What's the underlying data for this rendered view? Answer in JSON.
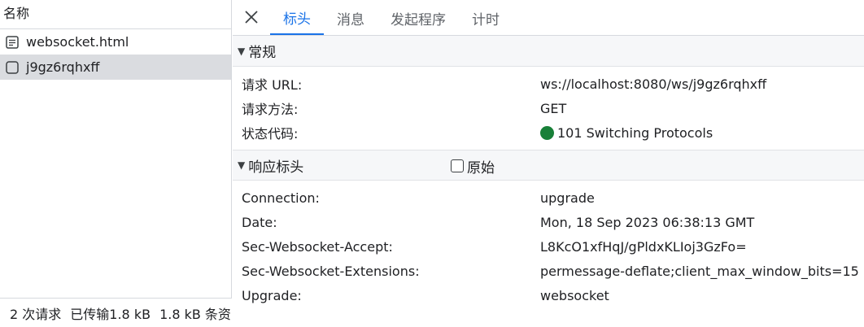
{
  "left": {
    "header": "名称",
    "requests": [
      {
        "name": "websocket.html",
        "icon": "document-icon"
      },
      {
        "name": "j9gz6rqhxff",
        "icon": "websocket-icon"
      }
    ],
    "status": {
      "requests": "2 次请求",
      "transferred": "已传输1.8 kB",
      "resources": "1.8 kB 条资"
    }
  },
  "tabs": {
    "items": [
      "标头",
      "消息",
      "发起程序",
      "计时"
    ],
    "active": "标头"
  },
  "general": {
    "title": "常规",
    "rows": [
      {
        "key": "请求 URL:",
        "value": "ws://localhost:8080/ws/j9gz6rqhxff"
      },
      {
        "key": "请求方法:",
        "value": "GET"
      },
      {
        "key": "状态代码:",
        "value": "101 Switching Protocols"
      }
    ],
    "status_color": "#188038"
  },
  "response_headers": {
    "title": "响应标头",
    "raw_label": "原始",
    "rows": [
      {
        "key": "Connection:",
        "value": "upgrade"
      },
      {
        "key": "Date:",
        "value": "Mon, 18 Sep 2023 06:38:13 GMT"
      },
      {
        "key": "Sec-Websocket-Accept:",
        "value": "L8KcO1xfHqJ/gPldxKLIoj3GzFo="
      },
      {
        "key": "Sec-Websocket-Extensions:",
        "value": "permessage-deflate;client_max_window_bits=15"
      },
      {
        "key": "Upgrade:",
        "value": "websocket"
      }
    ]
  },
  "colors": {
    "accent": "#1a73e8",
    "selected_row": "#dadce0",
    "section_bg": "#f6f7f9"
  }
}
